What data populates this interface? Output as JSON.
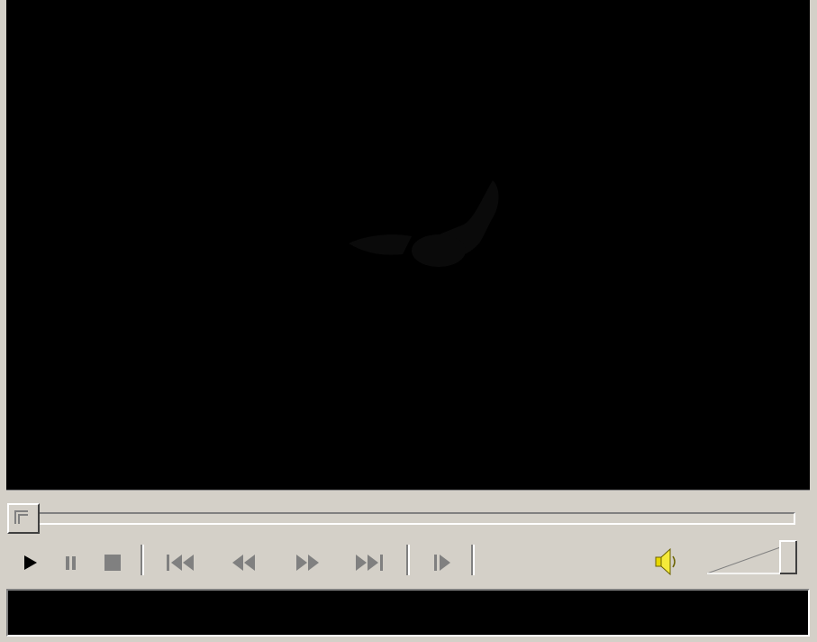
{
  "player": {
    "video": {
      "state": "stopped",
      "background": "#000000"
    },
    "seek": {
      "position": 0
    },
    "controls": [
      {
        "name": "play-button",
        "icon": "play-icon"
      },
      {
        "name": "pause-button",
        "icon": "pause-icon"
      },
      {
        "name": "stop-button",
        "icon": "stop-icon"
      },
      {
        "name": "previous-button",
        "icon": "skip-back-icon"
      },
      {
        "name": "rewind-button",
        "icon": "rewind-icon"
      },
      {
        "name": "fast-forward-button",
        "icon": "fast-forward-icon"
      },
      {
        "name": "next-button",
        "icon": "skip-forward-icon"
      },
      {
        "name": "step-frame-button",
        "icon": "frame-step-icon"
      }
    ],
    "volume": {
      "icon": "speaker-icon",
      "level": 1.0
    },
    "status": {
      "text": ""
    }
  },
  "colors": {
    "face": "#d4d0c8",
    "shadow": "#808080",
    "highlight": "#ffffff",
    "icon": "#000000",
    "disabled_icon": "#808080",
    "speaker": "#e8d800"
  }
}
